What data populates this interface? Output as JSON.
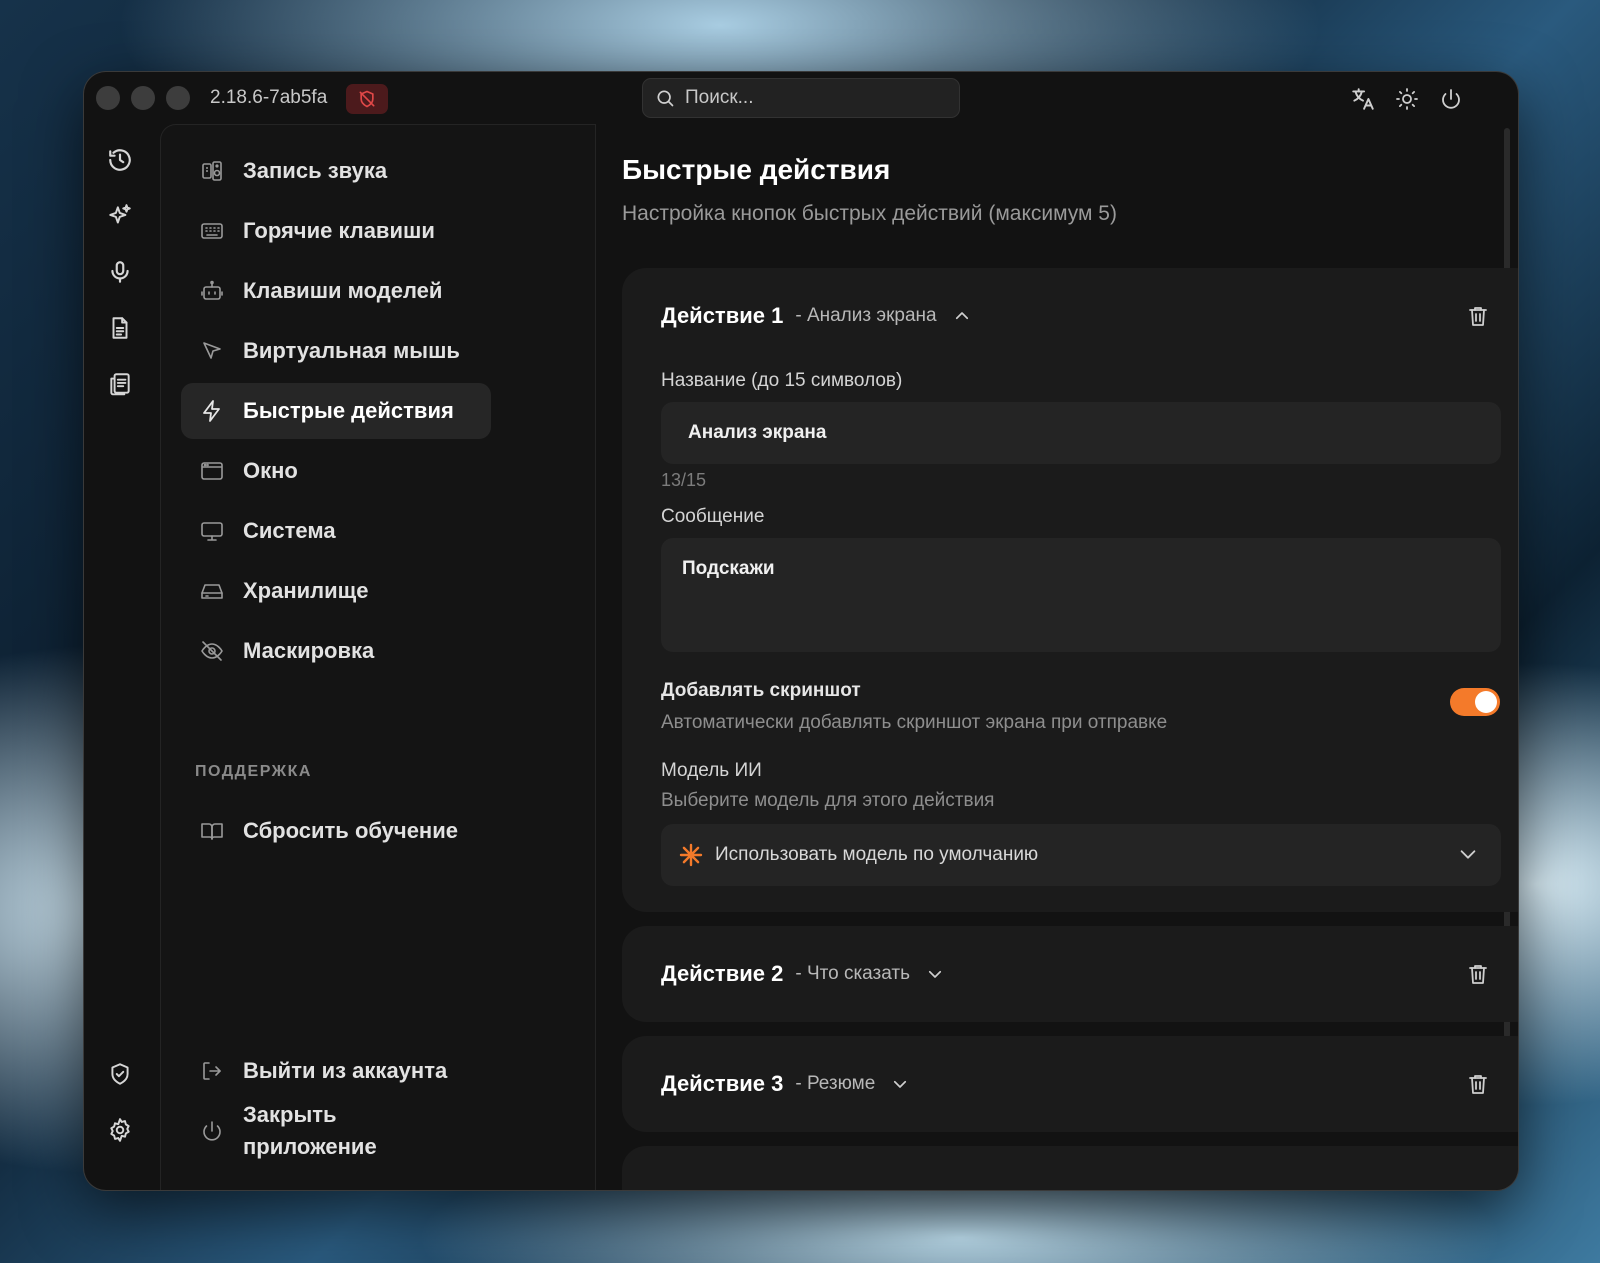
{
  "app": {
    "version": "2.18.6-7ab5fa",
    "search_placeholder": "Поиск..."
  },
  "icons": {
    "rail": [
      "history-icon",
      "sparkles-icon",
      "microphone-icon",
      "document-icon",
      "notes-icon",
      "shield-check-icon",
      "gear-icon"
    ],
    "titlebar": [
      "translate-icon",
      "sun-icon",
      "power-icon"
    ],
    "badge": "shield-off-icon"
  },
  "sidebar": {
    "items": [
      {
        "label": "Запись звука",
        "icon": "audio-device-icon"
      },
      {
        "label": "Горячие клавиши",
        "icon": "keyboard-icon"
      },
      {
        "label": "Клавиши моделей",
        "icon": "bot-icon"
      },
      {
        "label": "Виртуальная мышь",
        "icon": "cursor-icon"
      },
      {
        "label": "Быстрые действия",
        "icon": "lightning-icon",
        "active": true
      },
      {
        "label": "Окно",
        "icon": "window-icon"
      },
      {
        "label": "Система",
        "icon": "monitor-icon"
      },
      {
        "label": "Хранилище",
        "icon": "storage-icon"
      },
      {
        "label": "Маскировка",
        "icon": "eye-off-icon"
      }
    ],
    "support_label": "ПОДДЕРЖКА",
    "support_items": [
      {
        "label": "Сбросить обучение",
        "icon": "book-icon"
      }
    ],
    "bottom_items": [
      {
        "label": "Выйти из аккаунта",
        "icon": "logout-icon"
      },
      {
        "label": "Закрыть приложение",
        "icon": "power-icon"
      }
    ]
  },
  "main": {
    "title": "Быстрые действия",
    "subtitle": "Настройка кнопок быстрых действий (максимум 5)",
    "actions": [
      {
        "title": "Действие 1",
        "subtitle": "- Анализ экрана",
        "expanded": true,
        "name_label": "Название (до 15 символов)",
        "name_value": "Анализ экрана",
        "counter": "13/15",
        "message_label": "Сообщение",
        "message_value": "Подскажи",
        "screenshot_label": "Добавлять скриншот",
        "screenshot_desc": "Автоматически добавлять скриншот экрана при отправке",
        "screenshot_enabled": true,
        "model_label": "Модель ИИ",
        "model_desc": "Выберите модель для этого действия",
        "model_value": "Использовать модель по умолчанию"
      },
      {
        "title": "Действие 2",
        "subtitle": "- Что сказать",
        "expanded": false
      },
      {
        "title": "Действие 3",
        "subtitle": "- Резюме",
        "expanded": false
      }
    ]
  },
  "colors": {
    "accent": "#f47a2a",
    "window_bg": "#121212",
    "card_bg": "#1b1b1b",
    "badge_bg": "#4c1a1c",
    "badge_icon": "#e04848"
  }
}
